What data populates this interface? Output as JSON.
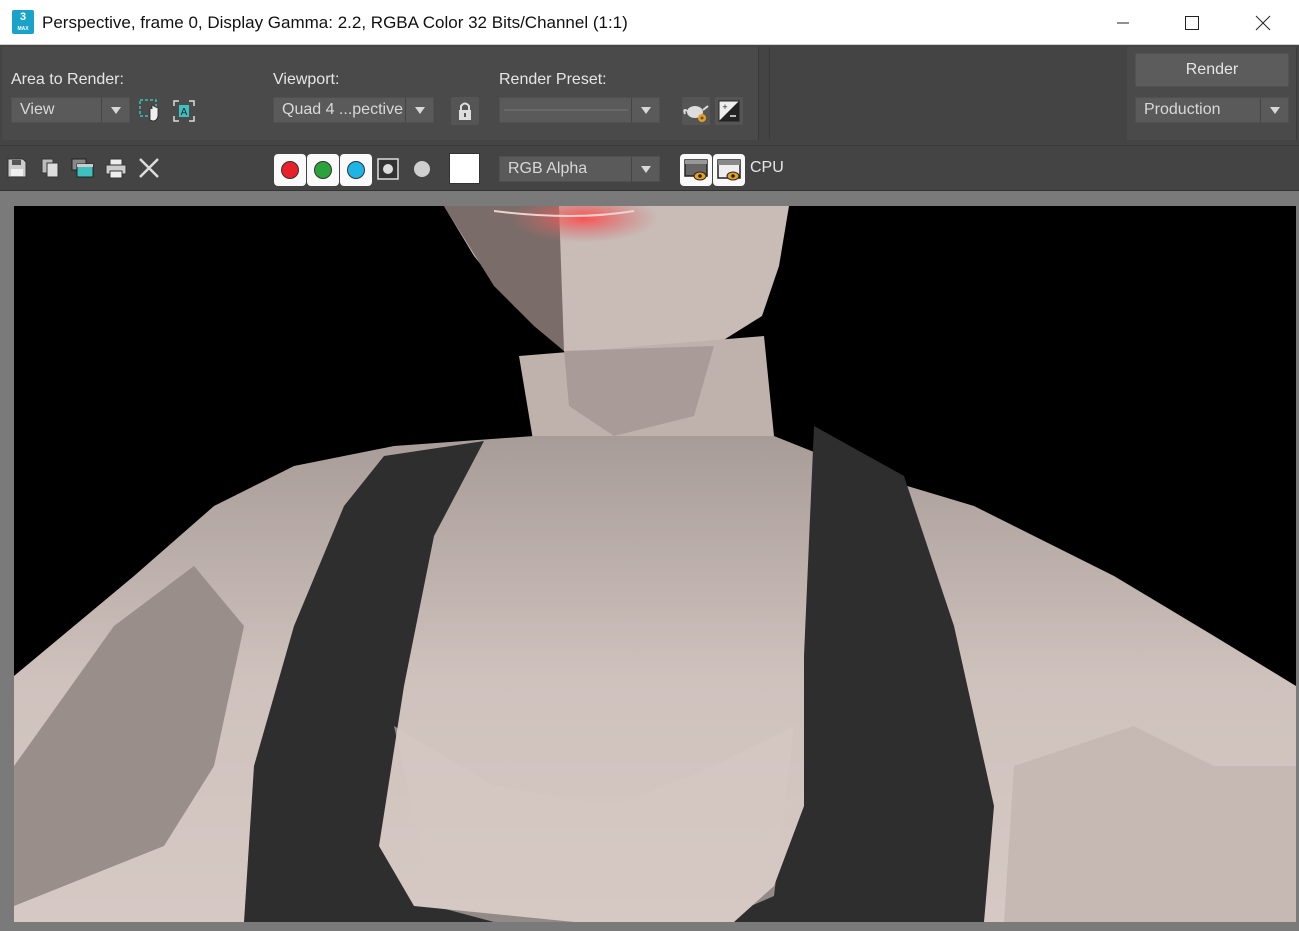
{
  "window": {
    "title": "Perspective, frame 0, Display Gamma: 2.2, RGBA Color 32 Bits/Channel (1:1)",
    "app_icon_label": "3",
    "app_icon_sub": "MAX"
  },
  "panel": {
    "area_label": "Area to Render:",
    "area_value": "View",
    "viewport_label": "Viewport:",
    "viewport_value": "Quad 4 ...pective",
    "preset_label": "Render Preset:",
    "preset_value": "",
    "render_button": "Render",
    "production_value": "Production"
  },
  "toolbar": {
    "channel_display_value": "RGB Alpha",
    "cpu_label": "CPU",
    "colors": {
      "red": "#e8202a",
      "green": "#2ca23c",
      "blue": "#1eb4e6",
      "gray": "#cfcfcf"
    }
  },
  "icons": [
    "save-icon",
    "copy-icon",
    "clone-window-icon",
    "print-icon",
    "clear-icon",
    "region-pan-icon",
    "auto-region-icon",
    "lock-icon",
    "teapot-settings-icon",
    "exposure-icon",
    "render-window-eye-icon",
    "render-window-eye-2-icon"
  ]
}
